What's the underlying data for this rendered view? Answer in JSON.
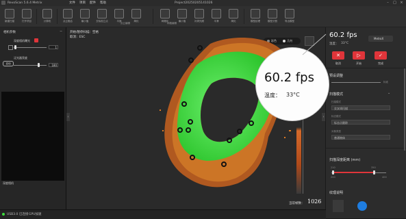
{
  "window": {
    "title": "RevoScan 5.6.4 Metrix",
    "project": "Project20250205141026"
  },
  "menu": [
    {
      "label": "文件"
    },
    {
      "label": "项目"
    },
    {
      "label": "配件"
    },
    {
      "label": "帮助"
    }
  ],
  "toolbar": {
    "buttons": [
      {
        "label": "新建扫描"
      },
      {
        "label": "打开项目"
      },
      {
        "label": "计算机"
      },
      {
        "label": "点云融合"
      },
      {
        "label": "最小值"
      },
      {
        "label": "去除孤立点"
      },
      {
        "label": "平面"
      },
      {
        "label": "简化"
      },
      {
        "label": "网格化"
      },
      {
        "label": "最小值"
      },
      {
        "label": "补洞光顺"
      },
      {
        "label": "平滑"
      },
      {
        "label": "简化"
      },
      {
        "label": "模型纹理"
      },
      {
        "label": "模型分割"
      },
      {
        "label": "导出模型"
      }
    ],
    "group_point": "点云编辑",
    "group_mesh": "网格编辑"
  },
  "left_panel": {
    "title": "相机参数",
    "depth_exposure": {
      "label": "深度相机曝光",
      "value": "1"
    },
    "flood_gain": {
      "label": "泛光器亮度",
      "value": "180"
    },
    "camera_label": "深度相机"
  },
  "viewport": {
    "hint_line1": "开始/暂停扫描：空格",
    "hint_line2": "取消：ESC",
    "mode_color": "彩色",
    "mode_geometry": "几何",
    "frame_label": "当前帧数：",
    "frame_value": "1026"
  },
  "right_panel": {
    "fps": "60.2 fps",
    "temp_label": "温度：",
    "temp_value": "33°C",
    "device_name": "MetroX",
    "cancel_label": "取消",
    "start_label": "开始",
    "finish_label": "完成",
    "preset_title": "预设调整",
    "preset_value": "标准",
    "scan_mode_title": "扫描模式",
    "scan_sub1": "扫描模式",
    "scan_val1": "交叉线扫描",
    "scan_sub2": "标志模式",
    "scan_val2": "标志点跟踪",
    "scan_sub3": "对象类型",
    "scan_val3": "普通物体",
    "distance_title": "扫描深度距离 (mm)",
    "dist_min": "210",
    "dist_max": "350",
    "dist_range_min": "200",
    "dist_range_max": "400",
    "texture_title": "纹理说明"
  },
  "magnifier": {
    "fps": "60.2 fps",
    "temp_label": "温度：",
    "temp_value": "33°C"
  },
  "status": {
    "usb": "USB3.0 已连接",
    "gpu": "GPU加速"
  },
  "colors": {
    "accent_red": "#e0353a",
    "point_green": "#3cdc3c",
    "point_orange": "#e0781e",
    "magnifier_bg": "#fdfdfd"
  }
}
